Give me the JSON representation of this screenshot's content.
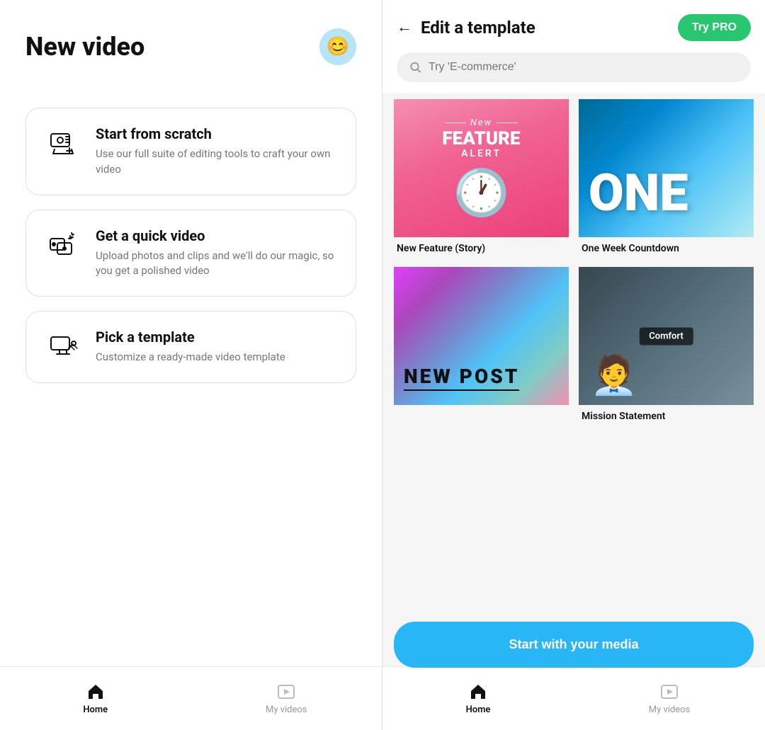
{
  "left": {
    "title": "New video",
    "avatar_emoji": "😊",
    "options": [
      {
        "id": "scratch",
        "title": "Start from scratch",
        "desc": "Use our full suite of editing tools to craft your own video",
        "icon": "editor-icon"
      },
      {
        "id": "quick",
        "title": "Get a quick video",
        "desc": "Upload photos and clips and we'll do our magic, so you get a polished video",
        "icon": "magic-icon"
      },
      {
        "id": "template",
        "title": "Pick a template",
        "desc": "Customize a ready-made video template",
        "icon": "template-icon"
      }
    ],
    "nav": {
      "home_label": "Home",
      "myvideos_label": "My videos"
    }
  },
  "right": {
    "back_label": "←",
    "title": "Edit a template",
    "try_pro_label": "Try PRO",
    "search_placeholder": "Try 'E-commerce'",
    "templates": [
      {
        "id": "new-feature",
        "label": "New Feature (Story)",
        "thumb_type": "pink",
        "content": {
          "new_text": "New",
          "title": "FEATURE",
          "sub": "ALERT"
        }
      },
      {
        "id": "one-week",
        "label": "One Week Countdown",
        "thumb_type": "ocean",
        "content": {
          "big_word": "ONE"
        }
      },
      {
        "id": "new-post",
        "label": "",
        "thumb_type": "holo",
        "content": {
          "text": "NEW POST"
        }
      },
      {
        "id": "mission",
        "label": "Mission Statement",
        "thumb_type": "dark",
        "content": {
          "badge": "Comfort"
        }
      }
    ],
    "start_media_label": "Start with your media",
    "nav": {
      "home_label": "Home",
      "myvideos_label": "My videos"
    }
  }
}
